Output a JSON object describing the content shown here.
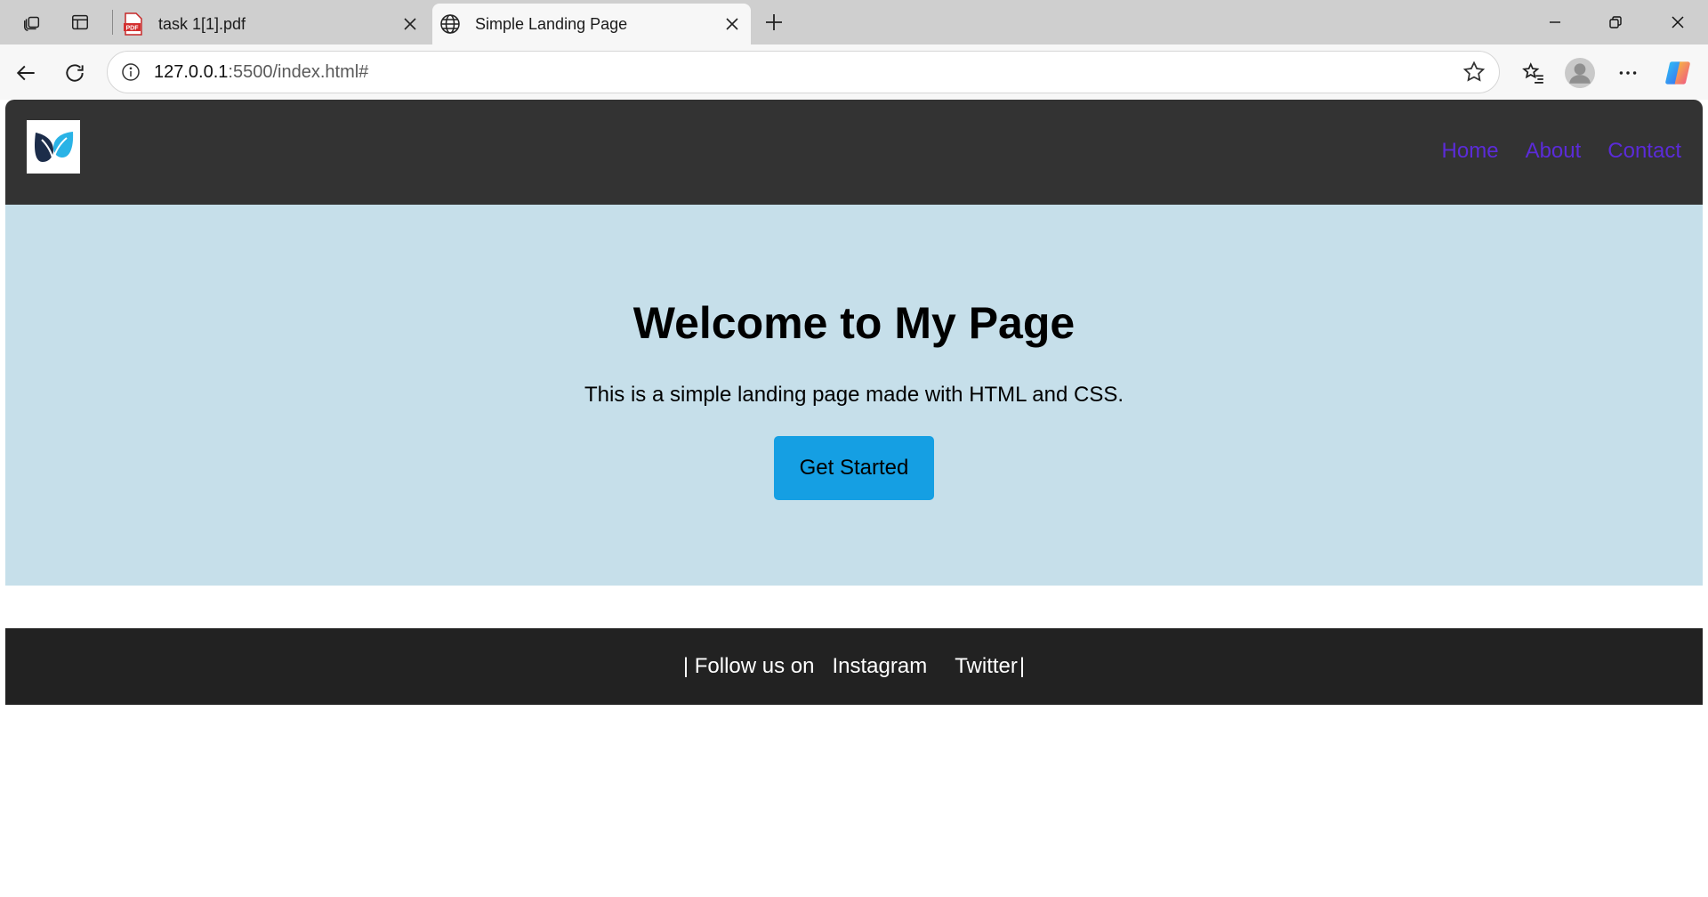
{
  "browser": {
    "tabs": [
      {
        "title": "task 1[1].pdf",
        "favicon": "pdf-icon",
        "active": false
      },
      {
        "title": "Simple Landing Page",
        "favicon": "globe-icon",
        "active": true
      }
    ],
    "url_host": "127.0.0.1",
    "url_path": ":5500/index.html#",
    "colors": {
      "tabstrip": "#cfcfcf",
      "toolbar": "#f7f7f7"
    }
  },
  "site": {
    "nav": [
      "Home",
      "About",
      "Contact"
    ],
    "hero": {
      "title": "Welcome to My Page",
      "subtitle": "This is a simple landing page made with HTML and CSS.",
      "cta": "Get Started"
    },
    "footer": {
      "prefix": "| Follow us on",
      "links": [
        "Instagram",
        "Twitter"
      ],
      "suffix": "|"
    },
    "colors": {
      "header": "#333333",
      "nav_link": "#5b2bd8",
      "hero_bg": "#c6dfea",
      "cta_bg": "#159fe3",
      "footer_bg": "#222222"
    }
  }
}
